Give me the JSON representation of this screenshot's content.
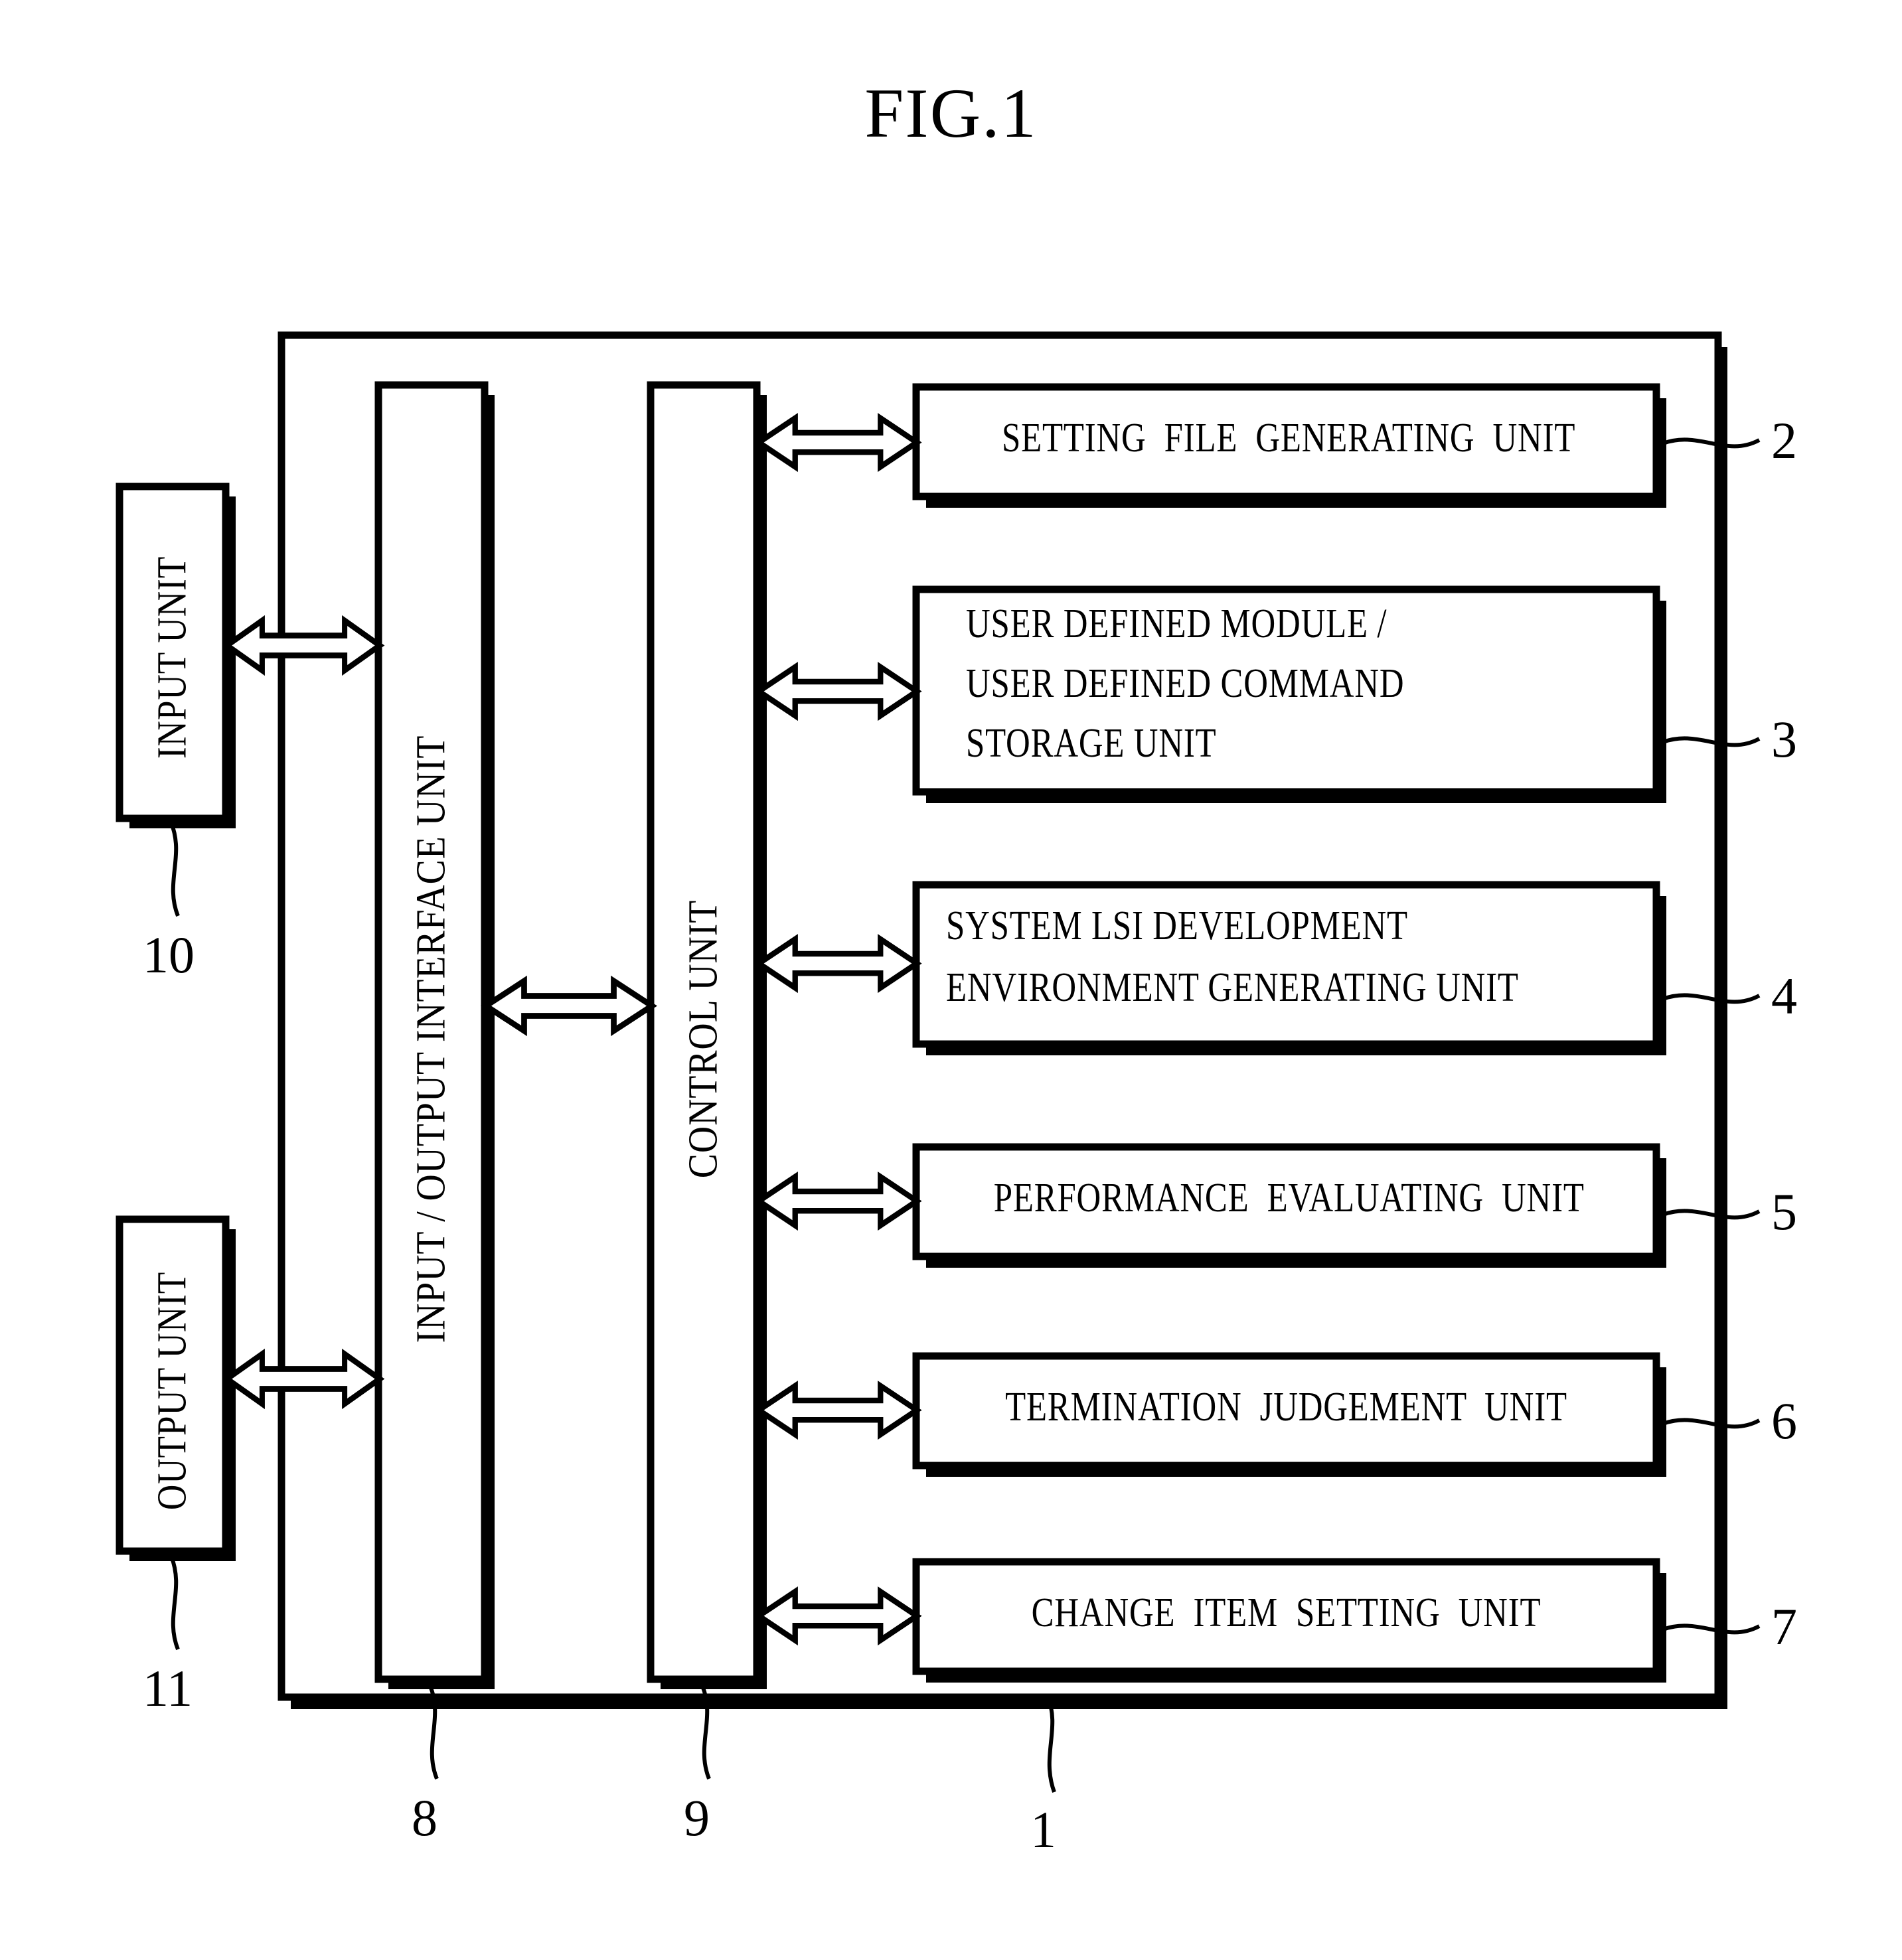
{
  "figure": {
    "title": "FIG.1"
  },
  "outer_system": {
    "ref": "1"
  },
  "left_units": [
    {
      "name": "input-unit",
      "label": "INPUT UNIT",
      "ref": "10"
    },
    {
      "name": "output-unit",
      "label": "OUTPUT UNIT",
      "ref": "11"
    }
  ],
  "vertical_bars": [
    {
      "name": "io-interface-unit",
      "label": "INPUT / OUTPUT INTERFACE UNIT",
      "ref": "8"
    },
    {
      "name": "control-unit",
      "label": "CONTROL UNIT",
      "ref": "9"
    }
  ],
  "function_blocks": [
    {
      "name": "setting-file-generating-unit",
      "lines": [
        "SETTING  FILE  GENERATING  UNIT"
      ],
      "ref": "2",
      "align": "center"
    },
    {
      "name": "user-defined-module-command-storage-unit",
      "lines": [
        "USER DEFINED MODULE /",
        "USER DEFINED COMMAND",
        "STORAGE UNIT"
      ],
      "ref": "3",
      "align": "left"
    },
    {
      "name": "system-lsi-development-environment-generating-unit",
      "lines": [
        "SYSTEM LSI DEVELOPMENT",
        "ENVIRONMENT GENERATING UNIT"
      ],
      "ref": "4",
      "align": "left"
    },
    {
      "name": "performance-evaluating-unit",
      "lines": [
        "PERFORMANCE  EVALUATING  UNIT"
      ],
      "ref": "5",
      "align": "center"
    },
    {
      "name": "termination-judgement-unit",
      "lines": [
        "TERMINATION  JUDGEMENT  UNIT"
      ],
      "ref": "6",
      "align": "center"
    },
    {
      "name": "change-item-setting-unit",
      "lines": [
        "CHANGE  ITEM  SETTING  UNIT"
      ],
      "ref": "7",
      "align": "center"
    }
  ],
  "connectors": {
    "description": "hollow double-headed arrows",
    "count": 8
  },
  "colors": {
    "ink": "#000000",
    "paper": "#ffffff"
  }
}
